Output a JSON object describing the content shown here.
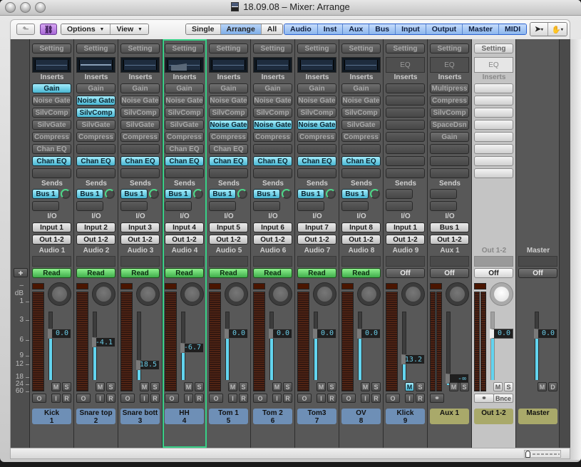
{
  "window": {
    "title": "18.09.08 – Mixer: Arrange",
    "title_icon": "document-icon"
  },
  "toolbar": {
    "back_icon": "up-arrow-icon",
    "link_icon": "link-icon",
    "options_label": "Options",
    "view_label": "View",
    "view_modes": [
      {
        "label": "Single",
        "active": false
      },
      {
        "label": "Arrange",
        "active": true
      },
      {
        "label": "All",
        "active": false
      }
    ],
    "filters": [
      "Audio",
      "Inst",
      "Aux",
      "Bus",
      "Input",
      "Output",
      "Master",
      "MIDI"
    ],
    "pointer_tool_icon": "arrow-pointer-icon",
    "hand_tool_icon": "hand-icon"
  },
  "scale": {
    "header": "– dB",
    "ticks": [
      "1",
      "3",
      "6",
      "9",
      "12",
      "18",
      "24",
      "60"
    ]
  },
  "labels": {
    "setting": "Setting",
    "inserts": "Inserts",
    "sends": "Sends",
    "io": "I/O",
    "eq": "EQ",
    "mute": "M",
    "solo": "S",
    "dim": "D",
    "rec_o": "O",
    "rec_i": "I",
    "rec_r": "R",
    "bounce": "Bnce",
    "add": "+"
  },
  "strips": [
    {
      "name": "Audio 1",
      "track": "Kick",
      "num": "1",
      "eq": "thumb",
      "inserts": [
        [
          "Gain",
          1
        ],
        [
          "Noise Gate",
          0
        ],
        [
          "SilvComp",
          0
        ],
        [
          "SilvGate",
          0
        ],
        [
          "Compress",
          0
        ],
        [
          "Chan EQ",
          0
        ],
        [
          "Chan EQ",
          1
        ],
        [
          "",
          0
        ]
      ],
      "send": "Bus 1",
      "input": "Input 1",
      "output": "Out 1-2",
      "automation": "Read",
      "fader": "0.0",
      "fader_level": 0.68,
      "mute_on": false,
      "type": "audio"
    },
    {
      "name": "Audio 2",
      "track": "Snare top",
      "num": "2",
      "eq": "curve",
      "inserts": [
        [
          "Gain",
          0
        ],
        [
          "Noise Gate",
          1
        ],
        [
          "SilvComp",
          1
        ],
        [
          "SilvGate",
          0
        ],
        [
          "Compress",
          0
        ],
        [
          "",
          0
        ],
        [
          "Chan EQ",
          1
        ],
        [
          "",
          0
        ]
      ],
      "send": "Bus 1",
      "input": "Input 2",
      "output": "Out 1-2",
      "automation": "Read",
      "fader": "-4.1",
      "fader_level": 0.55,
      "mute_on": false,
      "type": "audio"
    },
    {
      "name": "Audio 3",
      "track": "Snare bott",
      "num": "3",
      "eq": "thumb",
      "inserts": [
        [
          "Gain",
          0
        ],
        [
          "Noise Gate",
          0
        ],
        [
          "SilvComp",
          0
        ],
        [
          "SilvGate",
          0
        ],
        [
          "Compress",
          0
        ],
        [
          "",
          0
        ],
        [
          "Chan EQ",
          1
        ],
        [
          "",
          0
        ]
      ],
      "send": "Bus 1",
      "input": "Input 3",
      "output": "Out 1-2",
      "automation": "Read",
      "fader": "18.5",
      "fader_level": 0.22,
      "mute_on": false,
      "type": "audio"
    },
    {
      "name": "Audio 4",
      "track": "HH",
      "num": "4",
      "eq": "fill",
      "inserts": [
        [
          "Gain",
          0
        ],
        [
          "Noise Gate",
          0
        ],
        [
          "SilvComp",
          0
        ],
        [
          "SilvGate",
          0
        ],
        [
          "Compress",
          0
        ],
        [
          "Chan EQ",
          0
        ],
        [
          "Chan EQ",
          1
        ],
        [
          "",
          0
        ]
      ],
      "send": "Bus 1",
      "input": "Input 4",
      "output": "Out 1-2",
      "automation": "Read",
      "fader": "-6.7",
      "fader_level": 0.47,
      "mute_on": false,
      "type": "audio",
      "selected": true
    },
    {
      "name": "Audio 5",
      "track": "Tom 1",
      "num": "5",
      "eq": "thumb",
      "inserts": [
        [
          "Gain",
          0
        ],
        [
          "Noise Gate",
          0
        ],
        [
          "SilvComp",
          0
        ],
        [
          "Noise Gate",
          1
        ],
        [
          "Compress",
          0
        ],
        [
          "Chan EQ",
          0
        ],
        [
          "Chan EQ",
          1
        ],
        [
          "",
          0
        ]
      ],
      "send": "Bus 1",
      "input": "Input 5",
      "output": "Out 1-2",
      "automation": "Read",
      "fader": "0.0",
      "fader_level": 0.68,
      "mute_on": false,
      "type": "audio"
    },
    {
      "name": "Audio 6",
      "track": "Tom 2",
      "num": "6",
      "eq": "thumb",
      "inserts": [
        [
          "Gain",
          0
        ],
        [
          "Noise Gate",
          0
        ],
        [
          "SilvComp",
          0
        ],
        [
          "Noise Gate",
          1
        ],
        [
          "Compress",
          0
        ],
        [
          "",
          0
        ],
        [
          "Chan EQ",
          1
        ],
        [
          "",
          0
        ]
      ],
      "send": "Bus 1",
      "input": "Input 6",
      "output": "Out 1-2",
      "automation": "Read",
      "fader": "0.0",
      "fader_level": 0.68,
      "mute_on": false,
      "type": "audio"
    },
    {
      "name": "Audio 7",
      "track": "Tom3",
      "num": "7",
      "eq": "thumb",
      "inserts": [
        [
          "Gain",
          0
        ],
        [
          "Noise Gate",
          0
        ],
        [
          "SilvComp",
          0
        ],
        [
          "Noise Gate",
          1
        ],
        [
          "Compress",
          0
        ],
        [
          "",
          0
        ],
        [
          "Chan EQ",
          1
        ],
        [
          "",
          0
        ]
      ],
      "send": "Bus 1",
      "input": "Input 7",
      "output": "Out 1-2",
      "automation": "Read",
      "fader": "0.0",
      "fader_level": 0.68,
      "mute_on": false,
      "type": "audio"
    },
    {
      "name": "Audio 8",
      "track": "OV",
      "num": "8",
      "eq": "thumb",
      "inserts": [
        [
          "Gain",
          0
        ],
        [
          "Noise Gate",
          0
        ],
        [
          "SilvComp",
          0
        ],
        [
          "SilvGate",
          0
        ],
        [
          "Compress",
          0
        ],
        [
          "",
          0
        ],
        [
          "Chan EQ",
          1
        ],
        [
          "",
          0
        ]
      ],
      "send": "Bus 1",
      "input": "Input 8",
      "output": "Out 1-2",
      "automation": "Read",
      "fader": "0.0",
      "fader_level": 0.68,
      "mute_on": false,
      "type": "audio"
    },
    {
      "name": "Audio 9",
      "track": "Klick",
      "num": "9",
      "eq": "text",
      "inserts": [
        [
          "",
          0
        ],
        [
          "",
          0
        ],
        [
          "",
          0
        ],
        [
          "",
          0
        ],
        [
          "",
          0
        ],
        [
          "",
          0
        ],
        [
          "",
          0
        ],
        [
          "",
          0
        ]
      ],
      "send": "",
      "input": "Input 1",
      "output": "Out 1-2",
      "automation": "Off",
      "fader": "13.2",
      "fader_level": 0.3,
      "mute_on": true,
      "type": "audio"
    },
    {
      "name": "Aux 1",
      "track": "Aux 1",
      "num": "",
      "eq": "text",
      "inserts": [
        [
          "Multipress",
          0
        ],
        [
          "Compress",
          0
        ],
        [
          "SilvComp",
          0
        ],
        [
          "SpaceDsn",
          0
        ],
        [
          "Gain",
          0
        ],
        [
          "",
          0
        ],
        [
          "",
          0
        ],
        [
          "",
          0
        ]
      ],
      "send": "",
      "input": "Bus 1",
      "output": "Out 1-2",
      "automation": "Off",
      "fader": "-∞",
      "fader_level": 0.02,
      "mute_on": false,
      "type": "aux"
    },
    {
      "name": "Out 1-2",
      "track": "Out 1-2",
      "num": "",
      "eq": "text",
      "inserts": [
        [
          "",
          0
        ],
        [
          "",
          0
        ],
        [
          "",
          0
        ],
        [
          "",
          0
        ],
        [
          "",
          0
        ],
        [
          "",
          0
        ],
        [
          "",
          0
        ],
        [
          "",
          0
        ]
      ],
      "send": null,
      "input": null,
      "output": null,
      "automation": "Off",
      "fader": "0.0",
      "fader_level": 0.68,
      "mute_on": false,
      "type": "output"
    },
    {
      "name": "Master",
      "track": "Master",
      "num": "",
      "eq": null,
      "inserts": null,
      "send": null,
      "input": null,
      "output": null,
      "automation": "Off",
      "fader": "0.0",
      "fader_level": 0.68,
      "mute_on": false,
      "type": "master"
    }
  ]
}
